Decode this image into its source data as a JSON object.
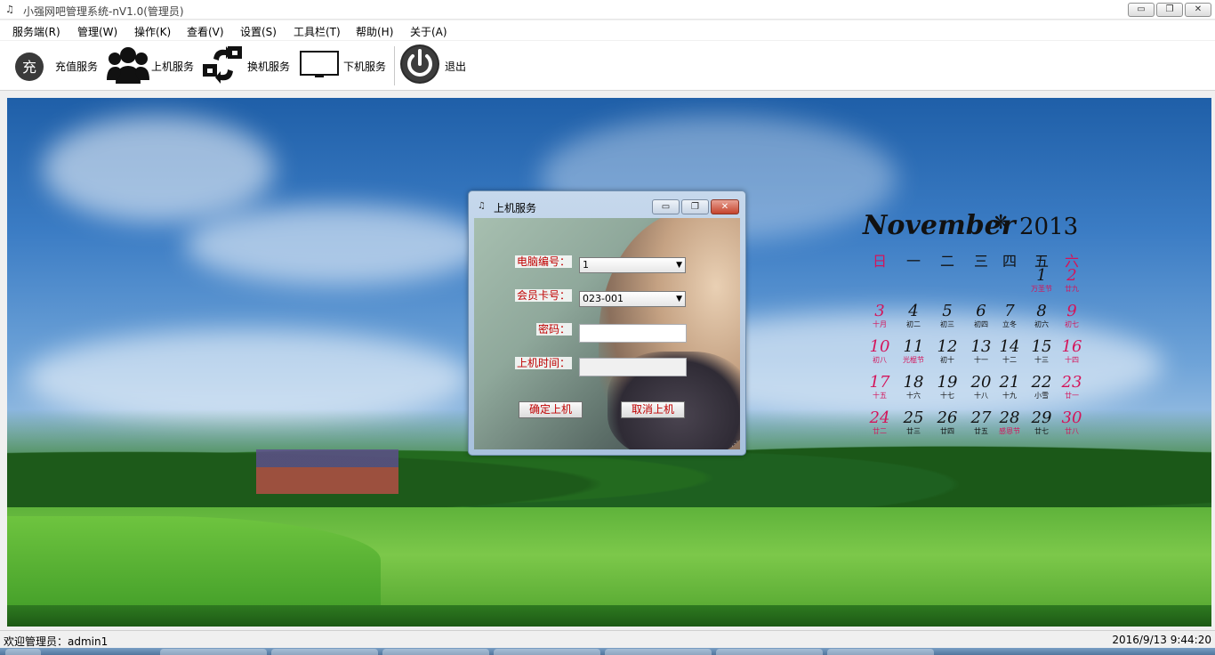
{
  "window": {
    "title": "小强网吧管理系统-nV1.0(管理员)",
    "min_glyph": "▭",
    "max_glyph": "❐",
    "close_glyph": "✕"
  },
  "menu": [
    {
      "label": "服务端(R)"
    },
    {
      "label": "管理(W)"
    },
    {
      "label": "操作(K)"
    },
    {
      "label": "查看(V)"
    },
    {
      "label": "设置(S)"
    },
    {
      "label": "工具栏(T)"
    },
    {
      "label": "帮助(H)"
    },
    {
      "label": "关于(A)"
    }
  ],
  "toolbar": {
    "recharge": {
      "label": "充值服务",
      "icon": "recharge-icon",
      "glyph": "充"
    },
    "login": {
      "label": "上机服务",
      "icon": "users-icon"
    },
    "switch": {
      "label": "换机服务",
      "icon": "swap-arrows-icon"
    },
    "logout": {
      "label": "下机服务",
      "icon": "monitor-icon"
    },
    "exit": {
      "label": "退出",
      "icon": "power-icon"
    }
  },
  "calendar": {
    "month": "November",
    "year": "2013",
    "weekdays": [
      "日",
      "一",
      "二",
      "三",
      "四",
      "五",
      "六"
    ],
    "days": [
      {
        "n": "1",
        "s": "万圣节",
        "red": false
      },
      {
        "n": "2",
        "s": "廿九",
        "red": true
      },
      {
        "n": "3",
        "s": "十月",
        "red": true
      },
      {
        "n": "4",
        "s": "初二",
        "red": false
      },
      {
        "n": "5",
        "s": "初三",
        "red": false
      },
      {
        "n": "6",
        "s": "初四",
        "red": false
      },
      {
        "n": "7",
        "s": "立冬",
        "red": false
      },
      {
        "n": "8",
        "s": "初六",
        "red": false
      },
      {
        "n": "9",
        "s": "初七",
        "red": true
      },
      {
        "n": "10",
        "s": "初八",
        "red": true
      },
      {
        "n": "11",
        "s": "光棍节",
        "red": false
      },
      {
        "n": "12",
        "s": "初十",
        "red": false
      },
      {
        "n": "13",
        "s": "十一",
        "red": false
      },
      {
        "n": "14",
        "s": "十二",
        "red": false
      },
      {
        "n": "15",
        "s": "十三",
        "red": false
      },
      {
        "n": "16",
        "s": "十四",
        "red": true
      },
      {
        "n": "17",
        "s": "十五",
        "red": true
      },
      {
        "n": "18",
        "s": "十六",
        "red": false
      },
      {
        "n": "19",
        "s": "十七",
        "red": false
      },
      {
        "n": "20",
        "s": "十八",
        "red": false
      },
      {
        "n": "21",
        "s": "十九",
        "red": false
      },
      {
        "n": "22",
        "s": "小雪",
        "red": false
      },
      {
        "n": "23",
        "s": "廿一",
        "red": true
      },
      {
        "n": "24",
        "s": "廿二",
        "red": true
      },
      {
        "n": "25",
        "s": "廿三",
        "red": false
      },
      {
        "n": "26",
        "s": "廿四",
        "red": false
      },
      {
        "n": "27",
        "s": "廿五",
        "red": false
      },
      {
        "n": "28",
        "s": "感恩节",
        "red": false
      },
      {
        "n": "29",
        "s": "廿七",
        "red": false
      },
      {
        "n": "30",
        "s": "廿八",
        "red": true
      }
    ],
    "red_color": "#d4145a"
  },
  "dialog": {
    "title": "上机服务",
    "computer_label": "电脑编号：",
    "computer_value": "1",
    "card_label": "会员卡号：",
    "card_value": "023-001",
    "password_label": "密码：",
    "password_value": "",
    "time_label": "上机时间：",
    "time_value": "",
    "confirm_label": "确定上机",
    "cancel_label": "取消上机",
    "label_color": "#c00000"
  },
  "status": {
    "welcome": "欢迎管理员：admin1",
    "datetime": "2016/9/13 9:44:20"
  }
}
